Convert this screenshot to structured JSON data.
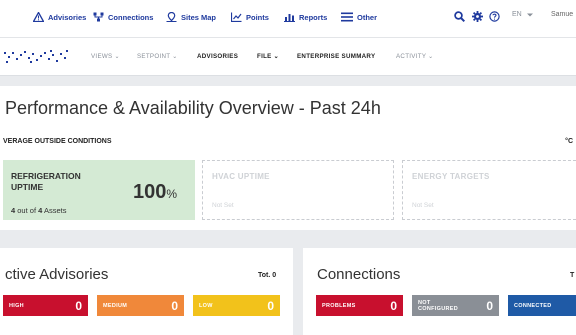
{
  "topnav": {
    "items": [
      {
        "label": "Advisories",
        "icon": "warning-icon"
      },
      {
        "label": "Connections",
        "icon": "network-icon"
      },
      {
        "label": "Sites Map",
        "icon": "map-pin-icon"
      },
      {
        "label": "Points",
        "icon": "chart-points-icon"
      },
      {
        "label": "Reports",
        "icon": "bar-chart-icon"
      },
      {
        "label": "Other",
        "icon": "menu-lines-icon"
      }
    ],
    "language": "EN",
    "user": "Samue"
  },
  "subnav": {
    "views": "VIEWS",
    "setpoint": "SETPOINT",
    "advisories": "ADVISORIES",
    "file": "FILE",
    "enterprise_summary": "ENTERPRISE SUMMARY",
    "activity": "ACTIVITY"
  },
  "overview": {
    "title": "Performance & Availability Overview - Past 24h",
    "subtitle": "VERAGE OUTSIDE CONDITIONS",
    "unit": "°C",
    "refrigeration": {
      "label_line1": "REFRIGERATION",
      "label_line2": "UPTIME",
      "value": "100",
      "unit": "%",
      "count": "4",
      "of_text": "out of",
      "total": "4",
      "assets": "Assets"
    },
    "hvac": {
      "label": "HVAC UPTIME",
      "status": "Not Set"
    },
    "energy": {
      "label": "ENERGY TARGETS",
      "status": "Not Set"
    }
  },
  "advisories": {
    "title": "ctive Advisories",
    "total": "Tot. 0",
    "high": {
      "label": "HIGH",
      "value": "0"
    },
    "medium": {
      "label": "MEDIUM",
      "value": "0"
    },
    "low": {
      "label": "LOW",
      "value": "0"
    }
  },
  "connections": {
    "title": "Connections",
    "total": "T",
    "problems": {
      "label": "PROBLEMS",
      "value": "0"
    },
    "not_configured": {
      "label_line1": "NOT",
      "label_line2": "CONFIGURED",
      "value": "0"
    },
    "connected": {
      "label": "CONNECTED"
    }
  },
  "colors": {
    "nav_blue": "#1f3a9e",
    "green_tile": "#d4ead4",
    "high_red": "#c8102e",
    "medium_orange": "#f0883a",
    "low_yellow": "#f2c21b",
    "not_configured_gray": "#8a8f96",
    "connected_blue": "#1f5aa6"
  }
}
